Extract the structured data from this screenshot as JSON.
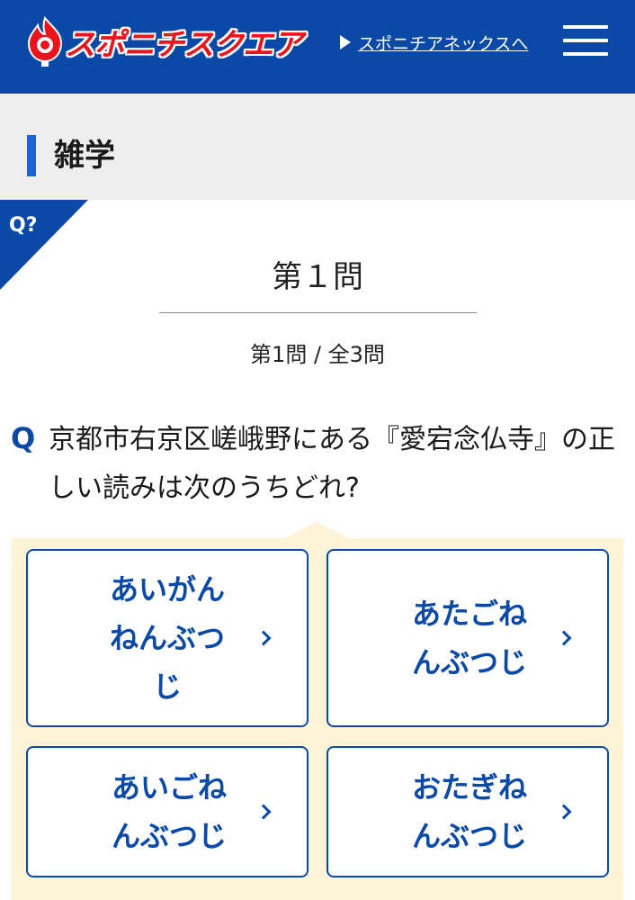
{
  "header": {
    "logo_text": "スポニチスクエア",
    "annex_link": "スポニチアネックスへ",
    "menu_icon": "hamburger-menu-icon"
  },
  "category": {
    "title": "雑学"
  },
  "quiz": {
    "corner_badge": "Q?",
    "question_number": "第１問",
    "progress": "第1問 / 全3問",
    "q_mark": "Q",
    "question_text": "京都市右京区嵯峨野にある『愛宕念仏寺』の正しい読みは次のうちどれ?"
  },
  "answers": [
    {
      "label": "あいがんねんぶつじ",
      "chevron": "chevron-right-icon"
    },
    {
      "label": "あたごねんぶつじ",
      "chevron": "chevron-right-icon"
    },
    {
      "label": "あいごねんぶつじ",
      "chevron": "chevron-right-icon"
    },
    {
      "label": "おたぎねんぶつじ",
      "chevron": "chevron-right-icon"
    }
  ],
  "colors": {
    "brand_blue": "#0b49a6",
    "accent_blue": "#1a63d1",
    "logo_red": "#e8141e",
    "answer_panel": "#fdf3d6",
    "category_band": "#eeeeee"
  }
}
